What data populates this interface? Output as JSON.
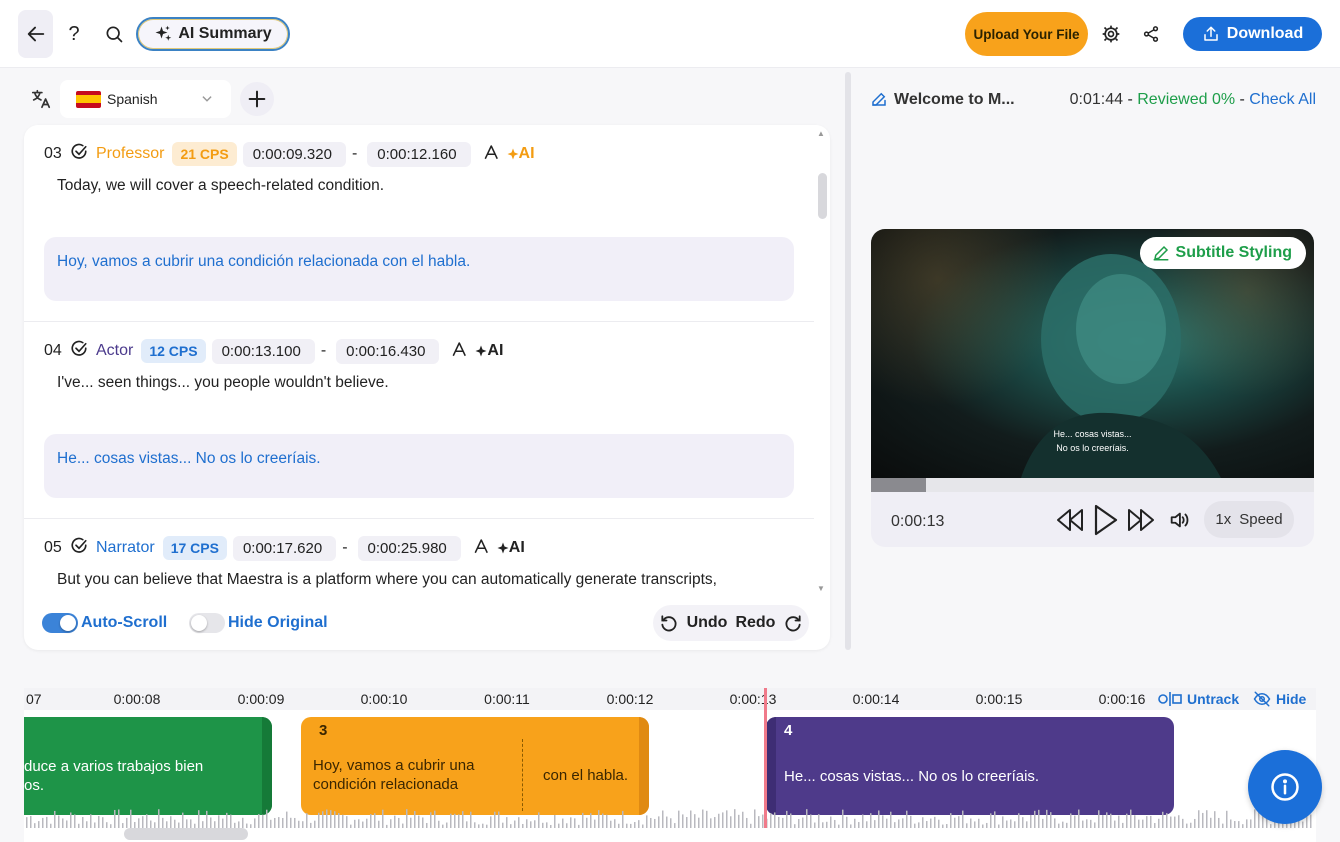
{
  "toolbar": {
    "help_label": "?",
    "ai_summary_label": "AI Summary",
    "upload_label": "Upload Your File",
    "download_label": "Download"
  },
  "language": {
    "selected": "Spanish"
  },
  "segments": [
    {
      "num": "03",
      "speaker": "Professor",
      "speaker_color": "#f39c12",
      "cps": "21 CPS",
      "cps_color": "#f39c12",
      "cps_bg": "#fdecd2",
      "start": "0:00:09.320",
      "end": "0:00:12.160",
      "ai_label": "AI",
      "original": "Today, we will cover a speech-related condition.",
      "translation": "Hoy, vamos a cubrir una condición relacionada con el habla."
    },
    {
      "num": "04",
      "speaker": "Actor",
      "speaker_color": "#4b3a8c",
      "cps": "12 CPS",
      "cps_color": "#1f6fcf",
      "cps_bg": "#e1ecfa",
      "start": "0:00:13.100",
      "end": "0:00:16.430",
      "ai_label": "AI",
      "original": "I've... seen things... you people wouldn't believe.",
      "translation": "He... cosas vistas... No os lo creeríais."
    },
    {
      "num": "05",
      "speaker": "Narrator",
      "speaker_color": "#1f6fcf",
      "cps": "17 CPS",
      "cps_color": "#1f6fcf",
      "cps_bg": "#e1ecfa",
      "start": "0:00:17.620",
      "end": "0:00:25.980",
      "ai_label": "AI",
      "original": "But you can believe that Maestra is a platform where you can automatically generate transcripts,",
      "translation": ""
    }
  ],
  "footer": {
    "auto_scroll_label": "Auto-Scroll",
    "auto_scroll_on": true,
    "hide_original_label": "Hide Original",
    "hide_original_on": false,
    "undo_label": "Undo",
    "redo_label": "Redo"
  },
  "file": {
    "title": "Welcome to M...",
    "duration": "0:01:44",
    "reviewed": "Reviewed 0%",
    "check_all": "Check All",
    "separator": " - "
  },
  "player": {
    "subtitle_styling_label": "Subtitle Styling",
    "subtitle_line1": "He... cosas vistas...",
    "subtitle_line2": "No os lo creeríais.",
    "current_time": "0:00:13",
    "progress": 0.125,
    "speed_value": "1x",
    "speed_label": "Speed"
  },
  "timeline": {
    "ticks": [
      "07",
      "0:00:08",
      "0:00:09",
      "0:00:10",
      "0:00:11",
      "0:00:12",
      "0:00:13",
      "0:00:14",
      "0:00:15",
      "0:00:16"
    ],
    "untrack_label": "Untrack",
    "hide_label": "Hide",
    "clips": [
      {
        "num": "",
        "text": "duce a varios trabajos bien os.",
        "text_line1": "duce a varios trabajos bien",
        "text_line2": "os."
      },
      {
        "num": "3",
        "text_line1": "Hoy, vamos a cubrir una",
        "text_line2": "condición relacionada",
        "text_right": "con el habla."
      },
      {
        "num": "4",
        "text": "He... cosas vistas... No os lo creeríais."
      }
    ]
  },
  "colors": {
    "accent_blue": "#1b6fd9",
    "upload_orange": "#f8a21b",
    "reviewed_green": "#1e9e4a"
  },
  "icons": {
    "back": "arrow-left-icon",
    "help": "question-icon",
    "search": "search-icon",
    "ai": "sparkles-icon",
    "settings": "gear-icon",
    "share": "share-icon",
    "download": "upload-tray-icon",
    "translate": "translate-icon",
    "info": "info-icon"
  }
}
